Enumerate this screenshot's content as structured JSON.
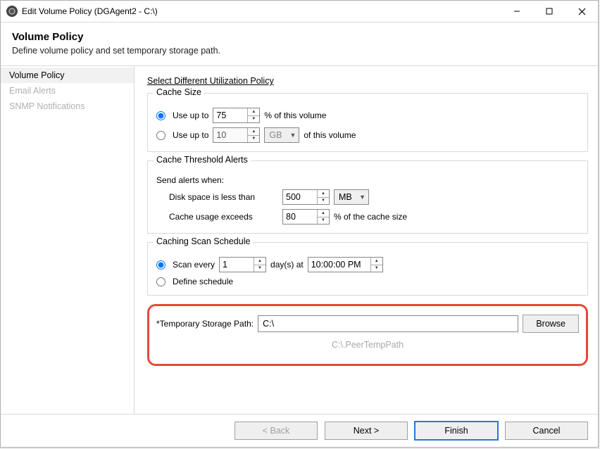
{
  "titlebar": {
    "title": "Edit Volume Policy (DGAgent2 - C:\\)"
  },
  "header": {
    "title": "Volume Policy",
    "subtitle": "Define volume policy and set temporary storage path."
  },
  "sidebar": {
    "items": [
      {
        "label": "Volume Policy",
        "active": true
      },
      {
        "label": "Email Alerts",
        "active": false
      },
      {
        "label": "SNMP Notifications",
        "active": false
      }
    ]
  },
  "content": {
    "select_link": "Select Different Utilization Policy",
    "cache_size": {
      "title": "Cache Size",
      "opt1_label": "Use up to",
      "opt1_value": "75",
      "opt1_suffix": "% of this volume",
      "opt2_label": "Use up to",
      "opt2_value": "10",
      "opt2_unit": "GB",
      "opt2_suffix": "of this volume"
    },
    "threshold": {
      "title": "Cache Threshold Alerts",
      "send_when": "Send alerts when:",
      "disk_label": "Disk space is less than",
      "disk_value": "500",
      "disk_unit": "MB",
      "usage_label": "Cache usage exceeds",
      "usage_value": "80",
      "usage_suffix": "% of the cache size"
    },
    "schedule": {
      "title": "Caching Scan Schedule",
      "opt1_label": "Scan every",
      "opt1_value": "1",
      "opt1_mid": "day(s) at",
      "opt1_time": "10:00:00 PM",
      "opt2_label": "Define schedule"
    },
    "tsp": {
      "label": "*Temporary Storage Path:",
      "value": "C:\\",
      "browse": "Browse",
      "resolved": "C:\\.PeerTempPath"
    }
  },
  "footer": {
    "back": "< Back",
    "next": "Next >",
    "finish": "Finish",
    "cancel": "Cancel"
  }
}
